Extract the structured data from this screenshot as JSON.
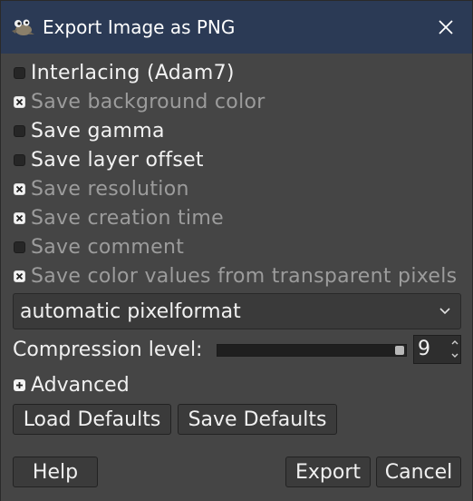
{
  "window": {
    "title": "Export Image as PNG",
    "icon": "gimp-wilber-icon",
    "close_icon": "close-icon"
  },
  "options": [
    {
      "label": "Interlacing (Adam7)",
      "checked": false,
      "enabled": true
    },
    {
      "label": "Save background color",
      "checked": true,
      "enabled": false
    },
    {
      "label": "Save gamma",
      "checked": false,
      "enabled": true
    },
    {
      "label": "Save layer offset",
      "checked": false,
      "enabled": true
    },
    {
      "label": "Save resolution",
      "checked": true,
      "enabled": false
    },
    {
      "label": "Save creation time",
      "checked": true,
      "enabled": false
    },
    {
      "label": "Save comment",
      "checked": false,
      "enabled": false
    },
    {
      "label": "Save color values from transparent pixels",
      "checked": true,
      "enabled": false
    }
  ],
  "pixelformat": {
    "selected": "automatic pixelformat"
  },
  "compression": {
    "label": "Compression level:",
    "value": "9",
    "fraction": 1.0
  },
  "advanced": {
    "label": "Advanced"
  },
  "buttons": {
    "load_defaults": "Load Defaults",
    "save_defaults": "Save Defaults",
    "help": "Help",
    "export": "Export",
    "cancel": "Cancel"
  },
  "colors": {
    "titlebar": "#2b3a55",
    "background": "#454545",
    "text_enabled": "#f2f2f2",
    "text_disabled": "#9c9c9c"
  }
}
